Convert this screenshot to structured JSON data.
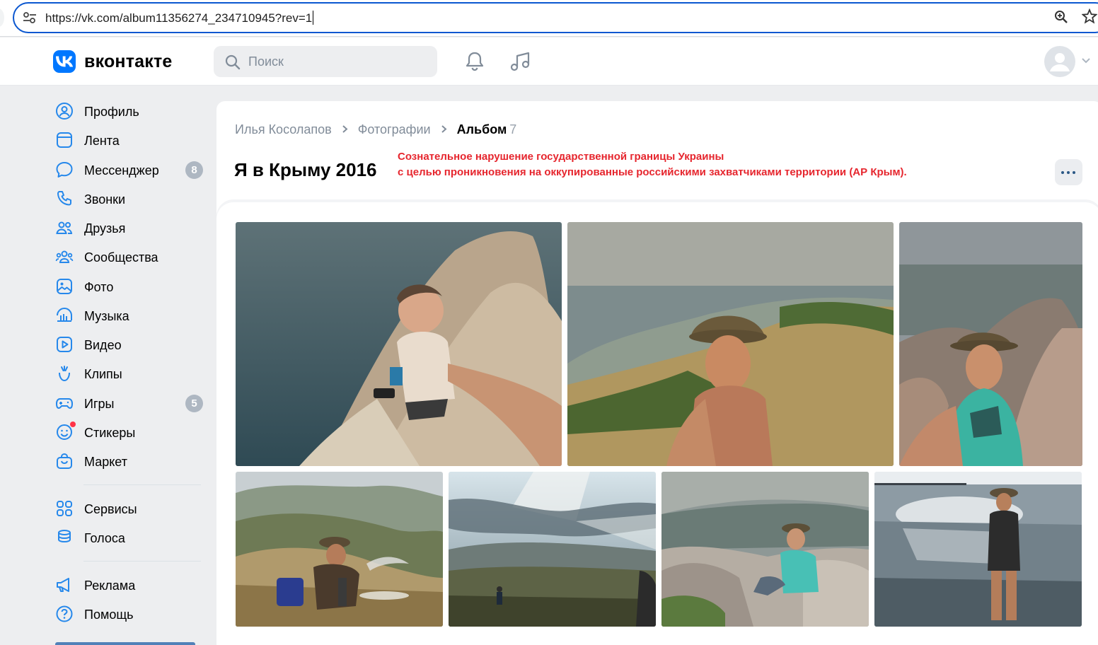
{
  "browser": {
    "url": "https://vk.com/album11356274_234710945?rev=1"
  },
  "header": {
    "logo_text": "вконтакте",
    "search_placeholder": "Поиск"
  },
  "sidebar": {
    "items": [
      {
        "label": "Профиль",
        "icon": "profile-icon"
      },
      {
        "label": "Лента",
        "icon": "feed-icon"
      },
      {
        "label": "Мессенджер",
        "icon": "messenger-icon",
        "badge": "8"
      },
      {
        "label": "Звонки",
        "icon": "phone-icon"
      },
      {
        "label": "Друзья",
        "icon": "friends-icon"
      },
      {
        "label": "Сообщества",
        "icon": "communities-icon"
      },
      {
        "label": "Фото",
        "icon": "photo-icon"
      },
      {
        "label": "Музыка",
        "icon": "music-icon"
      },
      {
        "label": "Видео",
        "icon": "video-icon"
      },
      {
        "label": "Клипы",
        "icon": "clips-icon"
      },
      {
        "label": "Игры",
        "icon": "games-icon",
        "badge": "5"
      },
      {
        "label": "Стикеры",
        "icon": "stickers-icon"
      },
      {
        "label": "Маркет",
        "icon": "market-icon"
      },
      {
        "label": "Сервисы",
        "icon": "services-icon"
      },
      {
        "label": "Голоса",
        "icon": "votes-icon"
      },
      {
        "label": "Реклама",
        "icon": "ads-icon"
      },
      {
        "label": "Помощь",
        "icon": "help-icon"
      }
    ]
  },
  "album": {
    "breadcrumb": {
      "owner": "Илья Косолапов",
      "section": "Фотографии",
      "current": "Альбом",
      "count": "7"
    },
    "title": "Я в Крыму 2016",
    "description_line1": "Сознательное нарушение государственной границы Украины",
    "description_line2": "с целью проникновения на оккупированные российскими захватчиками территории (АР Крым).",
    "description_color": "#e6262e",
    "photos": [
      {
        "name": "photo-cliff-selfie"
      },
      {
        "name": "photo-hat-coast-selfie"
      },
      {
        "name": "photo-rocks-selfie"
      },
      {
        "name": "photo-hookah-hills"
      },
      {
        "name": "photo-sunbeams-valley"
      },
      {
        "name": "photo-sitting-rocks"
      },
      {
        "name": "photo-sea-sunset"
      }
    ]
  },
  "colors": {
    "accent": "#0077ff",
    "badge": "#aeb7c2",
    "link_gray": "#818c99"
  }
}
